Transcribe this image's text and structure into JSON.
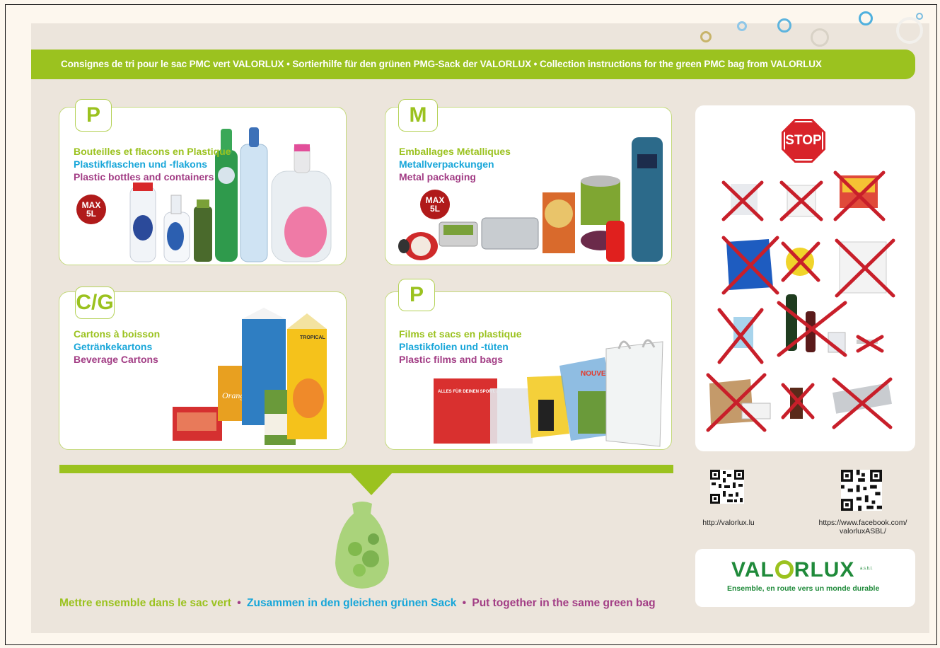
{
  "banner": {
    "text": "Consignes de tri pour le sac PMC vert VALORLUX  •  Sortierhilfe für den grünen PMG-Sack der VALORLUX  •  Collection instructions for the green PMC bag from VALORLUX"
  },
  "panels": [
    {
      "letter": "P",
      "fr": "Bouteilles et flacons en Plastique",
      "de": "Plastikflaschen und -flakons",
      "en": "Plastic bottles and containers",
      "badge_top": "MAX",
      "badge_bottom": "5L"
    },
    {
      "letter": "M",
      "fr": "Emballages Métalliques",
      "de": "Metallverpackungen",
      "en": "Metal packaging",
      "badge_top": "MAX",
      "badge_bottom": "5L"
    },
    {
      "letter": "C/G",
      "fr": "Cartons à boisson",
      "de": "Getränkekartons",
      "en": "Beverage Cartons"
    },
    {
      "letter": "P",
      "fr": "Films et sacs en plastique",
      "de": "Plastikfolien und -tüten",
      "en": "Plastic films and bags"
    }
  ],
  "product_labels": {
    "bag_text_1": "ALLES FÜR DEINEN SPORT. ALLES FÜR DICH",
    "bag_text_2": "NOUVEAU",
    "carton_text_1": "Orange",
    "carton_text_2": "TROPICAL"
  },
  "stop": {
    "label": "STOP"
  },
  "bottom": {
    "fr": "Mettre ensemble dans le sac vert",
    "sep": "•",
    "de": "Zusammen in den gleichen grünen Sack",
    "en": "Put together in the same green bag"
  },
  "qr_codes": [
    {
      "caption": "http://valorlux.lu"
    },
    {
      "caption": "https://www.facebook.com/ valorluxASBL/"
    }
  ],
  "logo": {
    "word_start": "VAL",
    "word_end": "RLUX",
    "asbl": "a.s.b.l.",
    "tagline": "Ensemble, en route vers un monde durable"
  },
  "colors": {
    "green": "#9bc21f",
    "blue": "#17a6d9",
    "purple": "#a23d85",
    "stop_red": "#d8232a",
    "logo_green": "#1f8a3a"
  }
}
